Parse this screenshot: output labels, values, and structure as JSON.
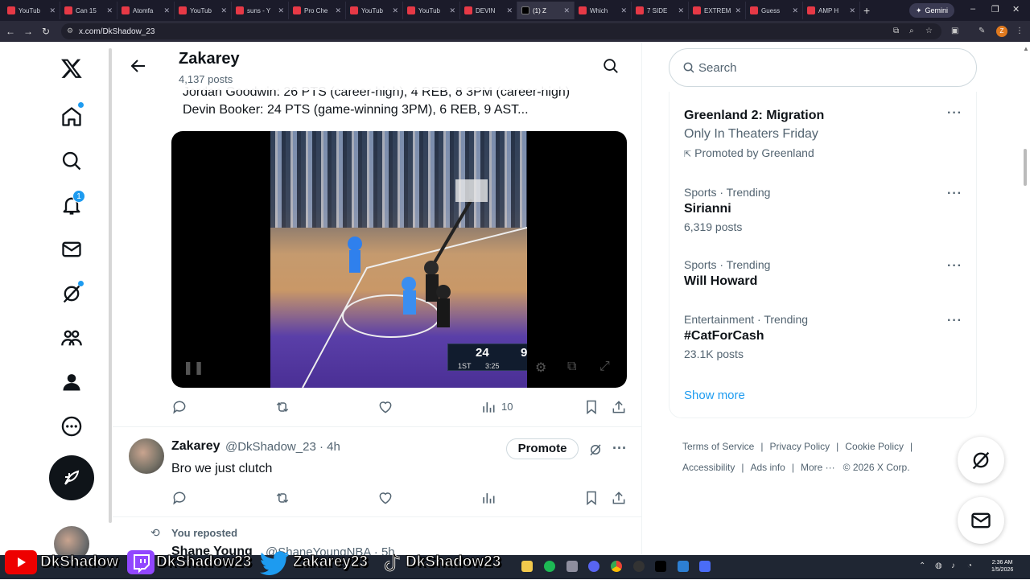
{
  "browser": {
    "tabs": [
      {
        "label": "YouTub",
        "icon": "youtube-icon"
      },
      {
        "label": "Can 15",
        "icon": "youtube-icon"
      },
      {
        "label": "Atomfa",
        "icon": "youtube-icon"
      },
      {
        "label": "YouTub",
        "icon": "youtube-icon"
      },
      {
        "label": "suns - Y",
        "icon": "youtube-icon"
      },
      {
        "label": "Pro Che",
        "icon": "youtube-icon"
      },
      {
        "label": "YouTub",
        "icon": "youtube-icon"
      },
      {
        "label": "YouTub",
        "icon": "youtube-icon"
      },
      {
        "label": "DEVIN",
        "icon": "youtube-icon"
      },
      {
        "label": "(1) Z",
        "icon": "x-icon",
        "active": true
      },
      {
        "label": "Which",
        "icon": "youtube-icon"
      },
      {
        "label": "7 SIDE",
        "icon": "youtube-icon"
      },
      {
        "label": "EXTREM",
        "icon": "youtube-icon"
      },
      {
        "label": "Guess",
        "icon": "youtube-icon"
      },
      {
        "label": "AMP H",
        "icon": "youtube-icon"
      }
    ],
    "new_tab": "+",
    "gemini_label": "Gemini",
    "url": "x.com/DkShadow_23",
    "profile_initial": "Z"
  },
  "nav": {
    "notifications_badge": "1"
  },
  "header": {
    "title": "Zakarey",
    "posts_count": "4,137 posts"
  },
  "tweet1": {
    "line1": "Jordan Goodwin: 26 PTS (career-high), 4 REB, 8 3PM (career-high)",
    "line2": "Devin Booker: 24 PTS (game-winning 3PM), 6 REB, 9 AST...",
    "media": {
      "score_home": "24",
      "score_away": "9",
      "quarter": "1ST",
      "clock": "3:25"
    },
    "views": "10"
  },
  "tweet2": {
    "name": "Zakarey",
    "handle_time": "@DkShadow_23 · 4h",
    "text": "Bro we just clutch",
    "promote_label": "Promote"
  },
  "tweet3": {
    "reposted_label": "You reposted",
    "name": "Shane Young",
    "handle_time": "@ShaneYoungNBA · 5h"
  },
  "search": {
    "placeholder": "Search"
  },
  "trends": [
    {
      "type": "promoted",
      "name": "Greenland 2: Migration",
      "sub": "Only In Theaters Friday",
      "promoted": "Promoted by Greenland"
    },
    {
      "meta": "Sports · Trending",
      "name": "Sirianni",
      "count": "6,319 posts"
    },
    {
      "meta": "Sports · Trending",
      "name": "Will Howard",
      "count": ""
    },
    {
      "meta": "Entertainment · Trending",
      "name": "#CatForCash",
      "count": "23.1K posts"
    }
  ],
  "show_more": "Show more",
  "footer": {
    "links": [
      "Terms of Service",
      "Privacy Policy",
      "Cookie Policy",
      "Accessibility",
      "Ads info",
      "More ···"
    ],
    "copyright": "© 2026 X Corp."
  },
  "overlay": {
    "youtube": "DkShadow",
    "twitch": "DkShadow23",
    "twitter": "Zakarey23",
    "tiktok": "DkShadow23"
  },
  "taskbar": {
    "time": "2:36 AM",
    "date": "1/5/2026"
  }
}
